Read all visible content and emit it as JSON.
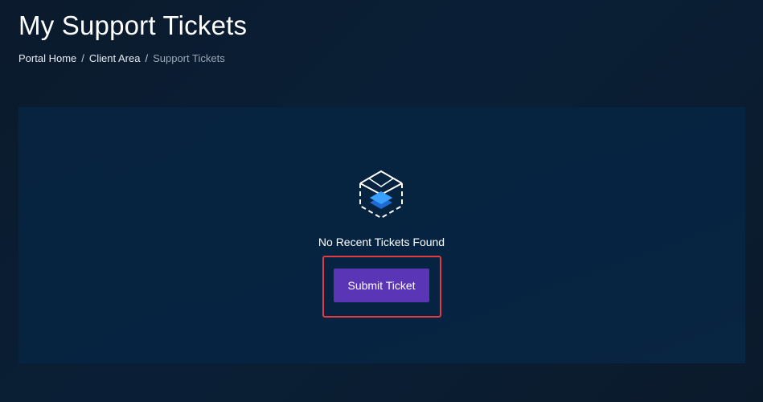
{
  "header": {
    "title": "My Support Tickets"
  },
  "breadcrumb": {
    "items": [
      "Portal Home",
      "Client Area"
    ],
    "current": "Support Tickets",
    "separator": "/"
  },
  "empty_state": {
    "icon": "envelope-layers-icon",
    "message": "No Recent Tickets Found",
    "button_label": "Submit Ticket"
  },
  "colors": {
    "button": "#5a35b6",
    "highlight": "#e03c44",
    "icon_accent": "#2f8fff"
  }
}
